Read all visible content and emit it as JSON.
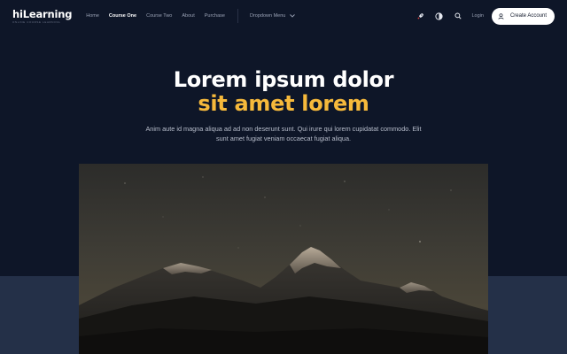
{
  "brand": {
    "name": "hiLearning",
    "tagline": "ONLINE COURSE LEARNING"
  },
  "nav": {
    "links": [
      {
        "label": "Home",
        "active": false
      },
      {
        "label": "Course One",
        "active": true
      },
      {
        "label": "Course Two",
        "active": false
      },
      {
        "label": "About",
        "active": false
      },
      {
        "label": "Purchase",
        "active": false
      }
    ],
    "dropdown_label": "Dropdown Menu",
    "login_label": "Login",
    "cta_label": "Create Account",
    "icons": [
      "rocket-icon",
      "contrast-icon",
      "search-icon",
      "user-icon",
      "chevron-down-icon"
    ]
  },
  "hero": {
    "title_line1": "Lorem ipsum dolor",
    "title_line2": "sit amet lorem",
    "subtitle": "Anim aute id magna aliqua ad ad non deserunt sunt. Qui irure qui lorem cupidatat commodo. Elit sunt amet fugiat veniam occaecat fugiat aliqua.",
    "image": "mountain-night-image"
  },
  "colors": {
    "background": "#0e1628",
    "band": "#243048",
    "accent": "#f6b93b",
    "cta_bg": "#ffffff"
  }
}
